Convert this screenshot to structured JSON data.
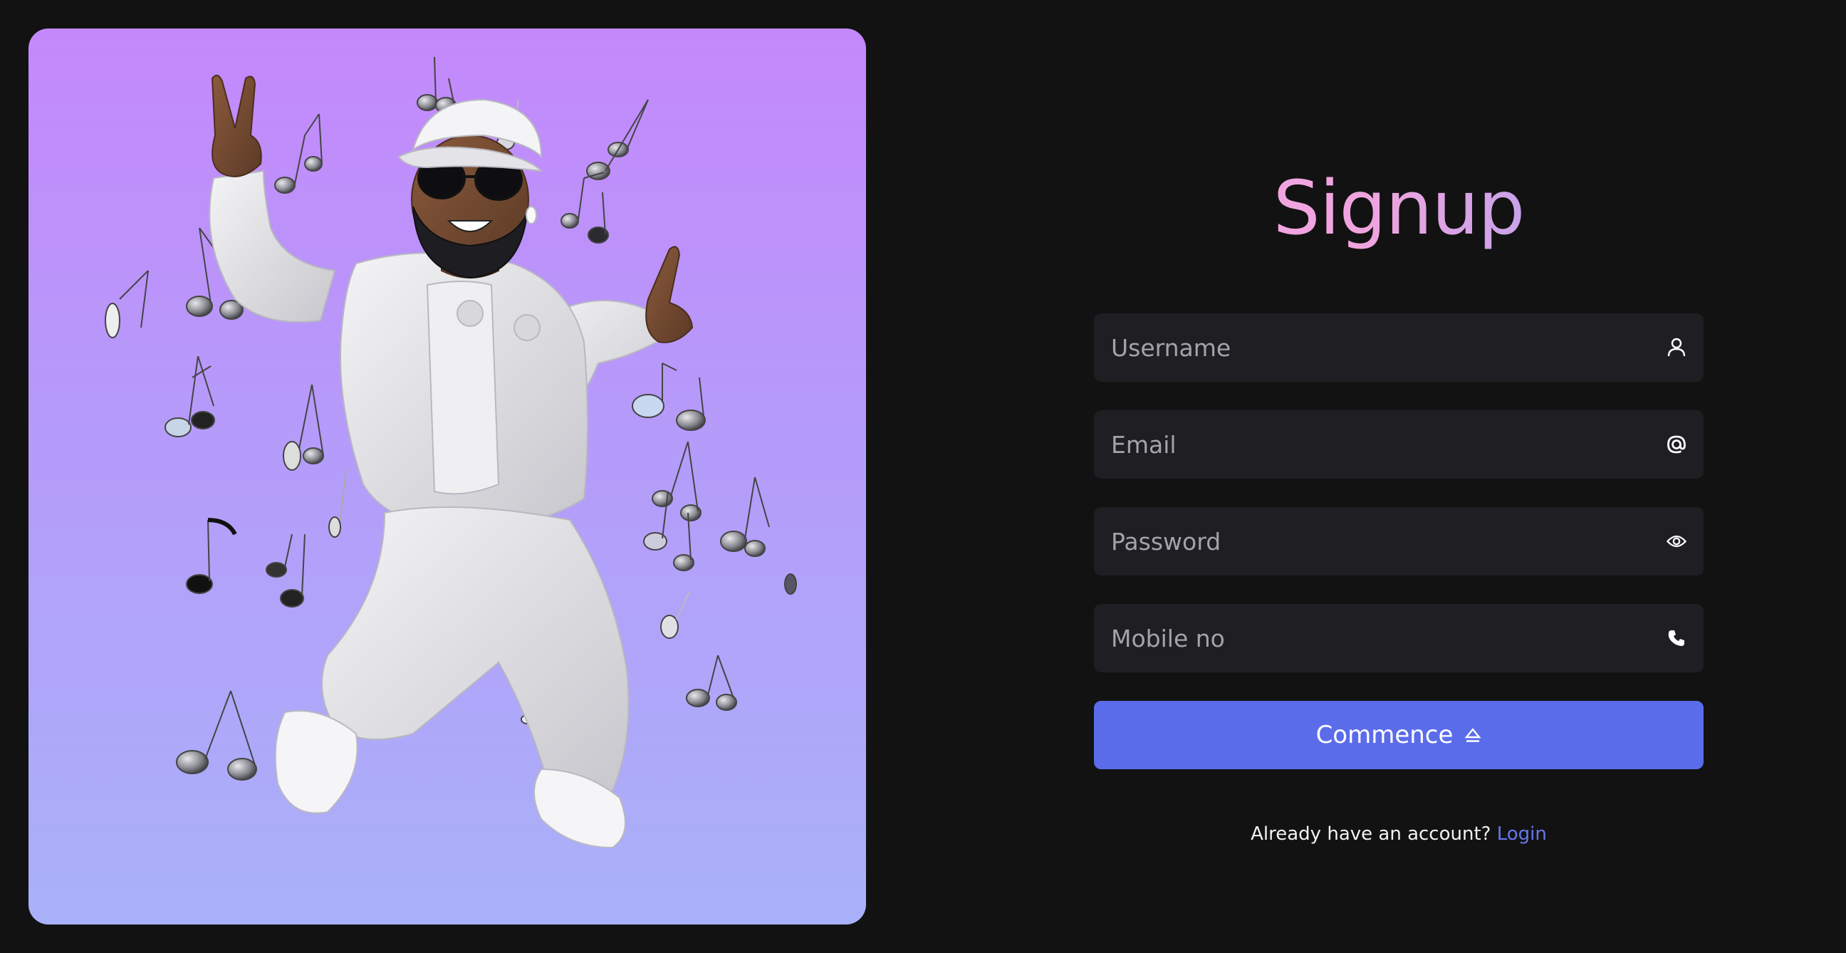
{
  "hero": {
    "image_subject": "dancing-3d-character-with-music-notes"
  },
  "signup": {
    "title": "Signup",
    "fields": {
      "username": {
        "placeholder": "Username",
        "icon": "user-icon"
      },
      "email": {
        "placeholder": "Email",
        "icon": "at-icon"
      },
      "password": {
        "placeholder": "Password",
        "icon": "eye-icon"
      },
      "mobile": {
        "placeholder": "Mobile no",
        "icon": "phone-icon"
      }
    },
    "submit_label": "Commence",
    "submit_icon": "eject-icon",
    "footer_text": "Already have an account?",
    "footer_link": "Login"
  },
  "colors": {
    "background": "#121212",
    "field_bg": "#1f1e23",
    "accent": "#5b6ceb",
    "link": "#6677ee",
    "title_gradient_start": "#f4a8e6",
    "title_gradient_end": "#9ba1f5",
    "hero_gradient_top": "#c488fb",
    "hero_gradient_bottom": "#a9b1f9"
  }
}
